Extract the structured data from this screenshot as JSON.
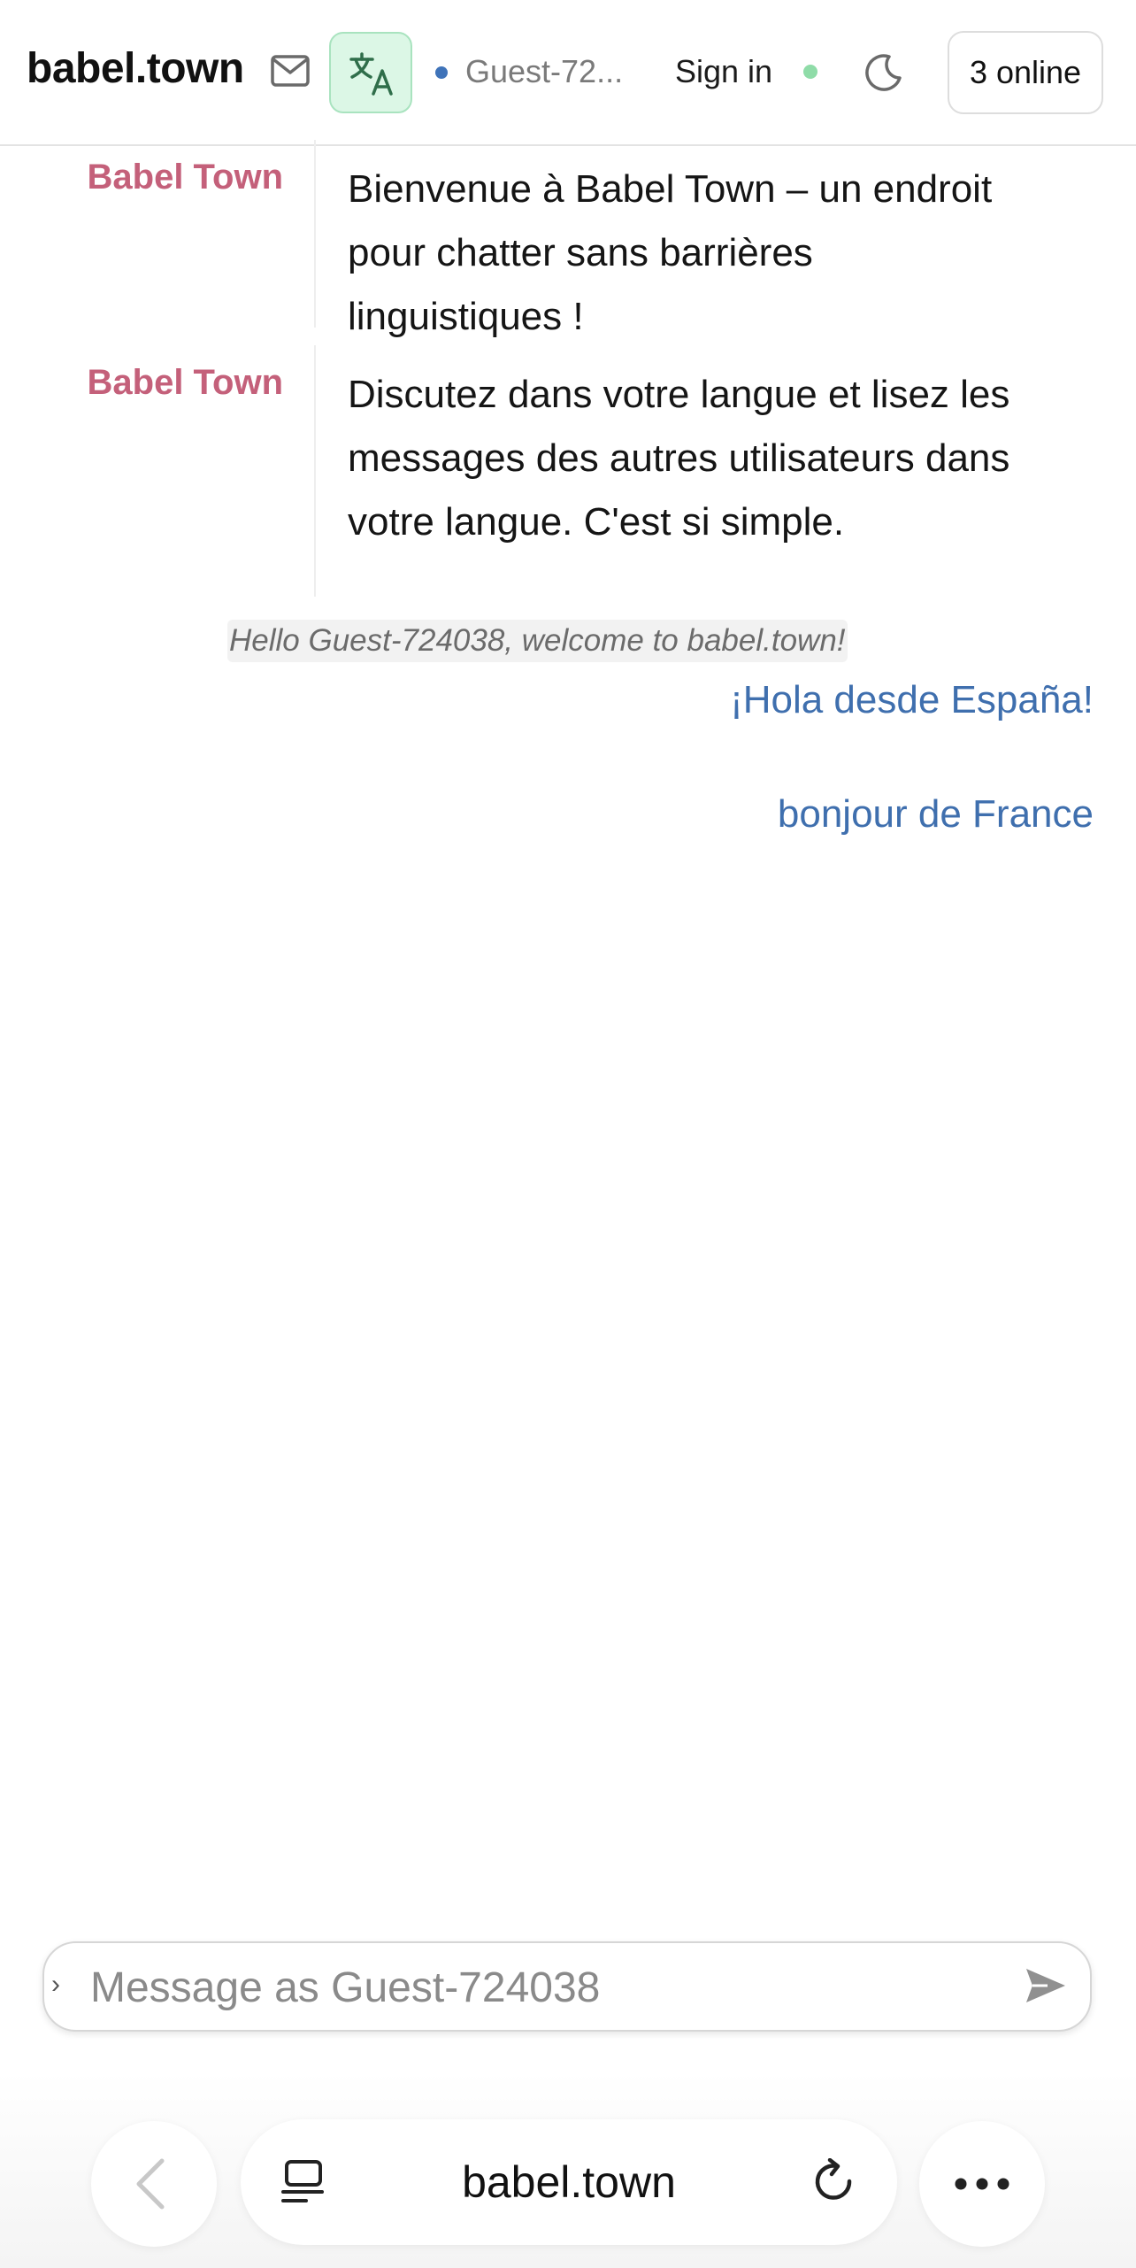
{
  "header": {
    "brand": "babel.town",
    "mail_icon": "mail-icon",
    "translate_icon": "translate-icon",
    "guest_name": "Guest-72...",
    "guest_status_color": "#3f73b9",
    "sign_in": "Sign in",
    "online_status_color": "#8fdca8",
    "theme_icon": "moon-icon",
    "online_count": "3 online"
  },
  "messages": [
    {
      "author": "Babel Town",
      "text": "Bienvenue à Babel Town – un endroit pour chatter sans barrières linguistiques !"
    },
    {
      "author": "Babel Town",
      "text": "Discutez dans votre langue et lisez les messages des autres utilisateurs dans votre langue. C'est si simple."
    }
  ],
  "system_note": "Hello Guest-724038, welcome to babel.town!",
  "user_messages": [
    "¡Hola desde España!",
    "bonjour de France"
  ],
  "composer": {
    "expand_glyph": "›",
    "placeholder": "Message as Guest-724038",
    "value": "",
    "send_icon": "send-icon"
  },
  "browser": {
    "back_icon": "chevron-left-icon",
    "tabs_icon": "tabs-icon",
    "url": "babel.town",
    "reload_icon": "reload-icon",
    "more_icon": "more-icon"
  },
  "colors": {
    "author": "#c4607a",
    "user_message": "#3f6fae",
    "translate_bg": "#dcf7e6"
  }
}
